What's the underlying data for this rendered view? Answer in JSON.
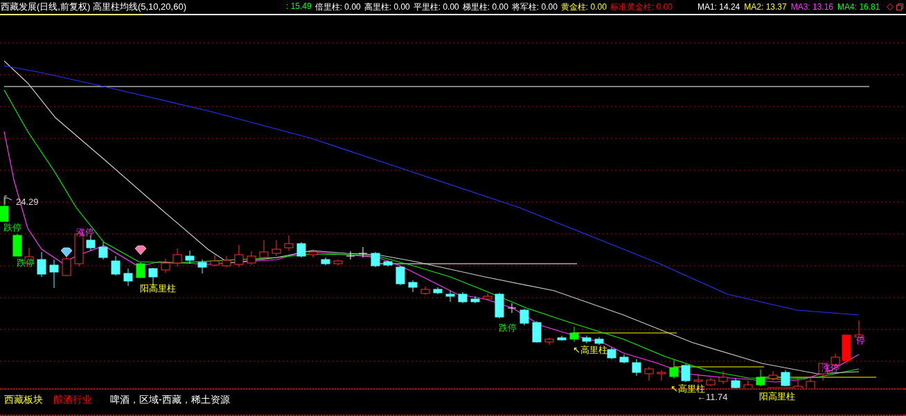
{
  "header": {
    "title": "西藏发展(日线,前复权) 高里柱均线(5,10,20,60)",
    "indicators": [
      {
        "text": ": 15.49",
        "color": "#00ff00"
      },
      {
        "text": "倍里柱: 0.00",
        "color": "#ffffff"
      },
      {
        "text": "高里柱: 0.00",
        "color": "#ffffff"
      },
      {
        "text": "平里柱: 0.00",
        "color": "#ffffff"
      },
      {
        "text": "梯里柱: 0.00",
        "color": "#ffffff"
      },
      {
        "text": "将军柱: 0.00",
        "color": "#ffffff"
      },
      {
        "text": "黄金柱: 0.00",
        "color": "#ffff00"
      },
      {
        "text": "标准黄金柱: 0.00",
        "color": "#ff0000"
      }
    ],
    "moving_averages": [
      {
        "text": "MA1: 14.24",
        "color": "#ffffff"
      },
      {
        "text": "MA2: 13.37",
        "color": "#ffff00"
      },
      {
        "text": "MA3: 13.16",
        "color": "#ff33ff"
      },
      {
        "text": "MA4: 16.81",
        "color": "#00ff00"
      }
    ]
  },
  "chart": {
    "labels": [
      {
        "text": "24.29",
        "kind": "price"
      },
      {
        "text": "跌停",
        "kind": "limit_down"
      },
      {
        "text": "跌停",
        "kind": "limit_down"
      },
      {
        "text": "涨停",
        "kind": "limit_up"
      },
      {
        "text": "阳高里柱",
        "kind": "volume"
      },
      {
        "text": "跌停",
        "kind": "limit_down"
      },
      {
        "text": "↖高里柱",
        "kind": "volume"
      },
      {
        "text": "↖高里柱",
        "kind": "volume"
      },
      {
        "text": "←11.74",
        "kind": "price"
      },
      {
        "text": "阳高里柱",
        "kind": "volume"
      },
      {
        "text": "涨停",
        "kind": "limit_up"
      },
      {
        "text": "停",
        "kind": "limit_up"
      }
    ]
  },
  "footer": {
    "tags": [
      {
        "text": "西藏板块",
        "color": "#ffff00"
      },
      {
        "text": "酿酒行业",
        "color": "#ff0000"
      },
      {
        "text": "啤酒，区域-西藏，稀土资源",
        "color": "#ffffff"
      }
    ]
  }
}
